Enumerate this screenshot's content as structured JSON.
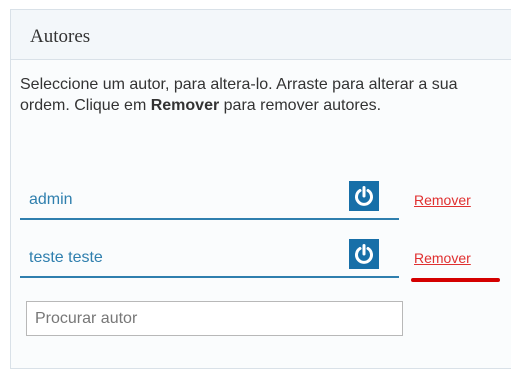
{
  "panel": {
    "title": "Autores",
    "description_part1": "Seleccione um autor, para altera-lo. Arraste para alterar a sua ordem. Clique em ",
    "description_bold": "Remover",
    "description_part2": " para remover autores."
  },
  "authors": [
    {
      "name": "admin",
      "remove_label": "Remover",
      "toggle_icon": "power-icon"
    },
    {
      "name": "teste teste",
      "remove_label": "Remover",
      "toggle_icon": "power-icon"
    }
  ],
  "search": {
    "placeholder": "Procurar autor",
    "value": ""
  },
  "colors": {
    "accent": "#2f7fae",
    "button": "#176fa8",
    "remove": "#e03030",
    "highlight": "#d40000"
  }
}
